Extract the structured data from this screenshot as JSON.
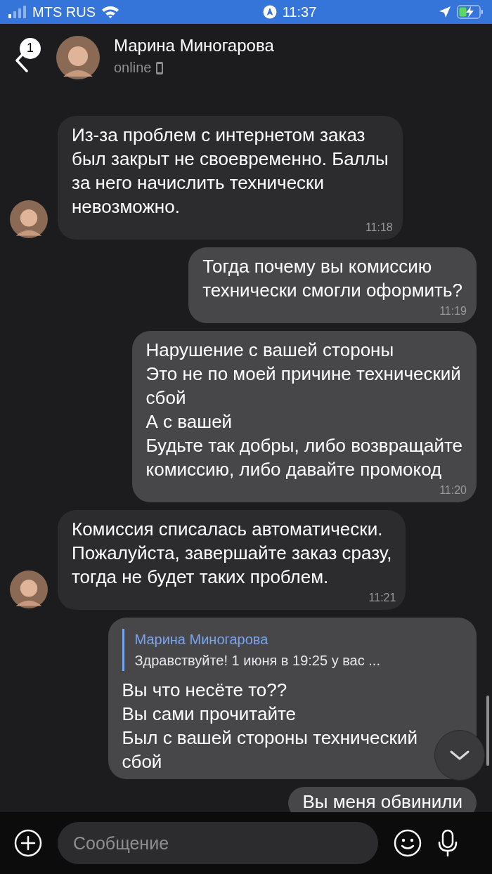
{
  "status_bar": {
    "carrier": "MTS RUS",
    "time": "11:37"
  },
  "header": {
    "back_badge": "1",
    "name": "Марина Миногарова",
    "status": "online"
  },
  "messages": [
    {
      "kind": "in",
      "avatar": true,
      "text": "Из-за проблем с интернетом заказ\nбыл закрыт не своевременно. Баллы\nза него начислить технически\nневозможно.",
      "time": "11:18"
    },
    {
      "kind": "out",
      "text": "Тогда почему вы комиссию\nтехнически смогли оформить?",
      "time": "11:19"
    },
    {
      "kind": "out",
      "text": "Нарушение с вашей стороны\nЭто не по моей причине технический\nсбой\nА с вашей\nБудьте так добры, либо возвращайте\nкомиссию, либо давайте промокод",
      "time": "11:20"
    },
    {
      "kind": "in",
      "avatar": true,
      "text": "Комиссия списалась автоматически.\nПожалуйста, завершайте заказ сразу,\nтогда не будет таких проблем.",
      "time": "11:21"
    },
    {
      "kind": "out",
      "reply": {
        "author": "Марина Миногарова",
        "text": "Здравствуйте! 1 июня в 19:25 у вас ..."
      },
      "text": "Вы что несёте то??\nВы сами прочитайте\nБыл с вашей стороны технический\nсбой"
    },
    {
      "kind": "out",
      "text": "Вы меня обвинили"
    }
  ],
  "composer": {
    "placeholder": "Сообщение"
  }
}
